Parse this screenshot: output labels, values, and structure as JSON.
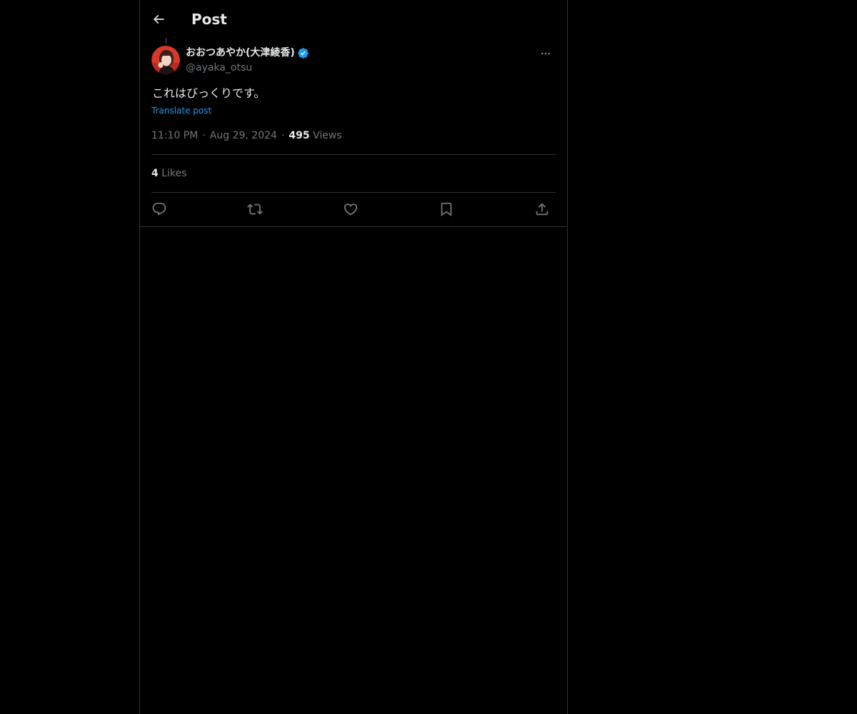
{
  "header": {
    "title": "Post"
  },
  "post": {
    "author": {
      "display_name": "おおつあやか(大津綾香)",
      "handle": "@ayaka_otsu",
      "verified": true
    },
    "text": "これはびっくりです。",
    "translate_label": "Translate post",
    "time": "11:10 PM",
    "date": "Aug 29, 2024",
    "views_count": "495",
    "views_label": "Views",
    "likes_count": "4",
    "likes_label": "Likes"
  },
  "icons": {
    "back": "back-arrow-icon",
    "more": "more-options-icon",
    "verified": "verified-badge-icon",
    "reply": "reply-icon",
    "repost": "repost-icon",
    "like": "like-icon",
    "bookmark": "bookmark-icon",
    "share": "share-icon"
  },
  "colors": {
    "background": "#000000",
    "text_primary": "#e7e9ea",
    "text_secondary": "#71767b",
    "accent": "#1d9bf0",
    "border": "#2f3336"
  }
}
